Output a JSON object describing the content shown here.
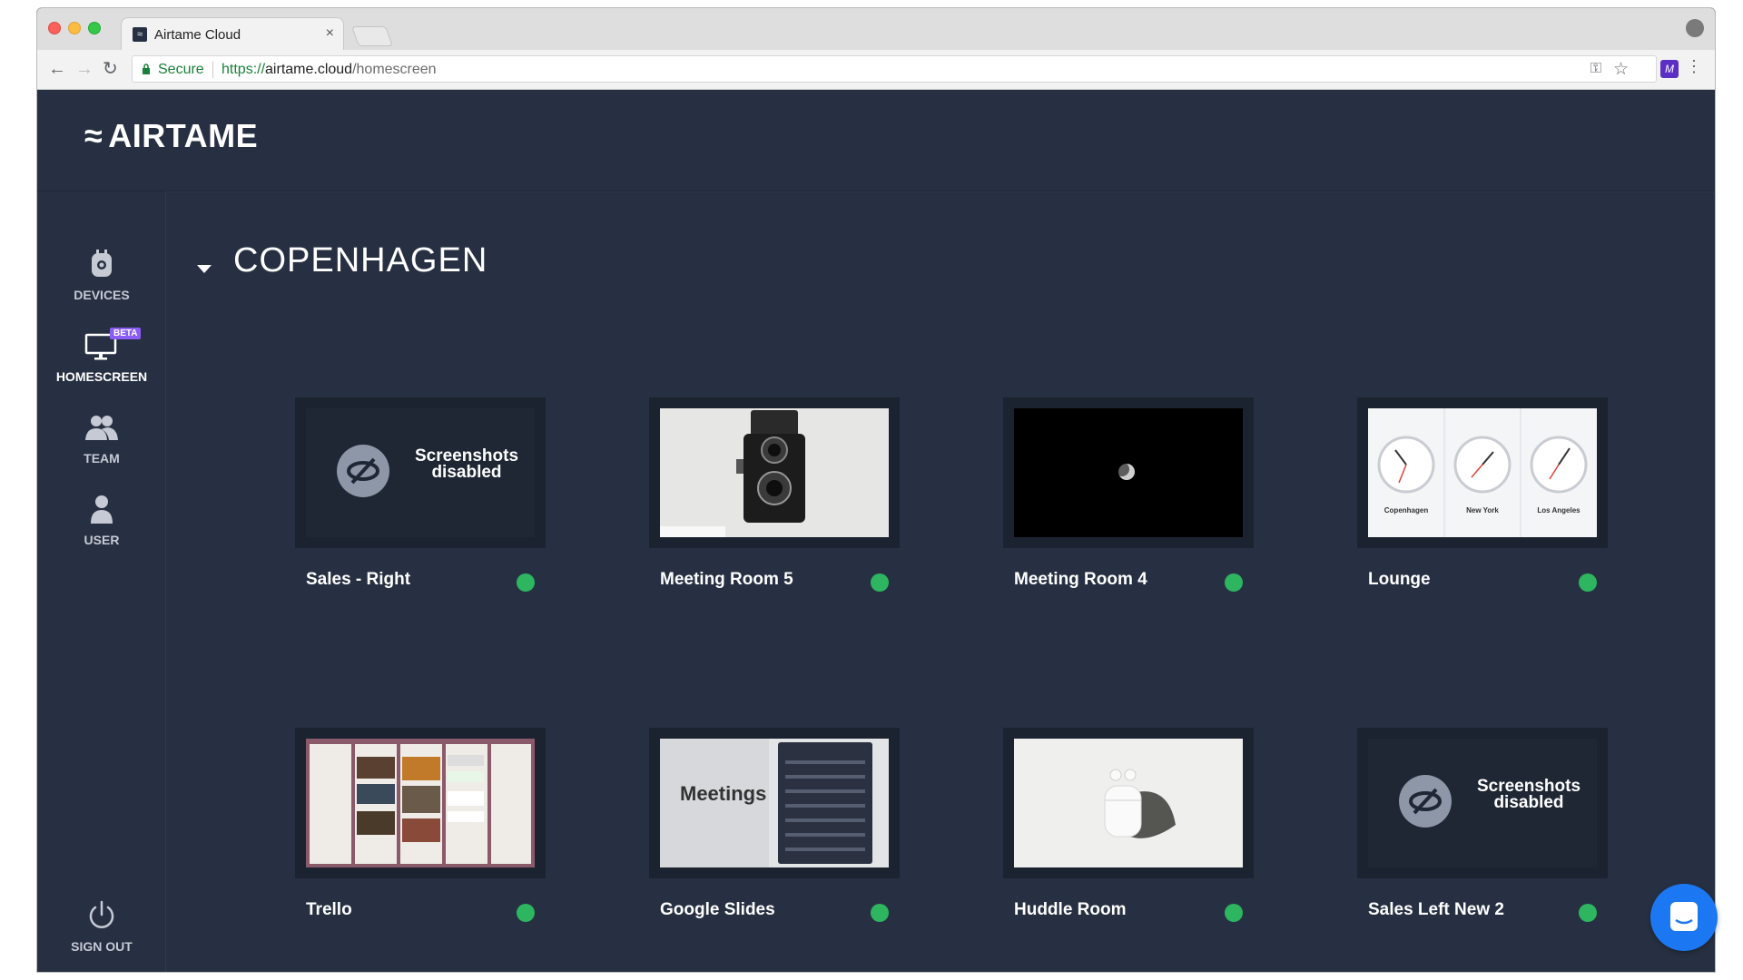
{
  "browser": {
    "tab_title": "Airtame Cloud",
    "tab_close": "×",
    "security_label": "Secure",
    "url_scheme": "https://",
    "url_host": "airtame.cloud",
    "url_path": "/homescreen"
  },
  "app": {
    "logo_text": "AIRTAME",
    "logo_mark": "≈"
  },
  "sidebar": {
    "items": [
      {
        "label": "DEVICES",
        "icon": "devices-icon",
        "active": false
      },
      {
        "label": "HOMESCREEN",
        "icon": "homescreen-icon",
        "active": true,
        "badge": "BETA"
      },
      {
        "label": "TEAM",
        "icon": "team-icon",
        "active": false
      },
      {
        "label": "USER",
        "icon": "user-icon",
        "active": false
      }
    ],
    "sign_out": "SIGN OUT"
  },
  "main": {
    "group_title": "COPENHAGEN",
    "devices": [
      {
        "name": "Sales - Right",
        "status": "online",
        "preview": "screenshots-disabled",
        "disabled_text": "Screenshots disabled"
      },
      {
        "name": "Meeting Room 5",
        "status": "online",
        "preview": "camera"
      },
      {
        "name": "Meeting Room 4",
        "status": "online",
        "preview": "moon"
      },
      {
        "name": "Lounge",
        "status": "online",
        "preview": "clocks",
        "clocks": [
          "Copenhagen",
          "New York",
          "Los Angeles"
        ]
      },
      {
        "name": "Trello",
        "status": "online",
        "preview": "trello"
      },
      {
        "name": "Google Slides",
        "status": "online",
        "preview": "slides",
        "slide_title": "Meetings"
      },
      {
        "name": "Huddle Room",
        "status": "online",
        "preview": "airpods"
      },
      {
        "name": "Sales Left New 2",
        "status": "online",
        "preview": "screenshots-disabled",
        "disabled_text": "Screenshots disabled"
      }
    ]
  },
  "colors": {
    "background": "#273042",
    "status_online": "#2db560",
    "beta_badge": "#8b5cf6",
    "chat_button": "#1b78f2"
  }
}
